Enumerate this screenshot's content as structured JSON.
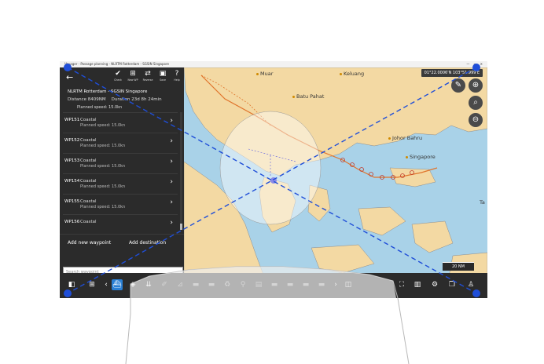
{
  "window": {
    "title": "Voyager - Passage planning - NLRTM Rotterdam - SGSIN Singapore",
    "controls": "— ▫ ✕"
  },
  "map": {
    "coords": "01°22.0006'N 103°51.999'E",
    "labels": {
      "muar": "Muar",
      "keluang": "Keluang",
      "batu_pahat": "Batu Pahat",
      "johor_bahru": "Johor Bahru",
      "singapore": "Singapore",
      "ta": "Ta"
    },
    "scale": "20 NM"
  },
  "panel": {
    "toolbar": {
      "check": "Check",
      "new_wp": "New WP",
      "reverse": "Reverse",
      "save": "Save",
      "help": "Help"
    },
    "route_name": "NLRTM Rotterdam - SGSIN Singapore",
    "distance": "Distance 8409NM",
    "duration": "Duration 23d 8h 24min",
    "partial_speed": "Planned speed: 15.0kn",
    "waypoints": [
      {
        "id": "WP151",
        "type": "Coastal",
        "speed": "Planned speed: 15.0kn"
      },
      {
        "id": "WP152",
        "type": "Coastal",
        "speed": "Planned speed: 15.0kn"
      },
      {
        "id": "WP153",
        "type": "Coastal",
        "speed": "Planned speed: 15.0kn"
      },
      {
        "id": "WP154",
        "type": "Coastal",
        "speed": "Planned speed: 15.0kn"
      },
      {
        "id": "WP155",
        "type": "Coastal",
        "speed": "Planned speed: 15.0kn"
      },
      {
        "id": "WP156",
        "type": "Coastal",
        "speed": ""
      }
    ],
    "add_waypoint": "Add new waypoint",
    "add_destination": "Add destination",
    "search_placeholder": "Search waypoint"
  },
  "colors": {
    "sea": "#a9d2e8",
    "land": "#f3d9a3",
    "shallow": "#cde6f4",
    "route": "#e0742b",
    "accent": "#2a7fd4",
    "overlay_line": "#1f4ed8"
  }
}
